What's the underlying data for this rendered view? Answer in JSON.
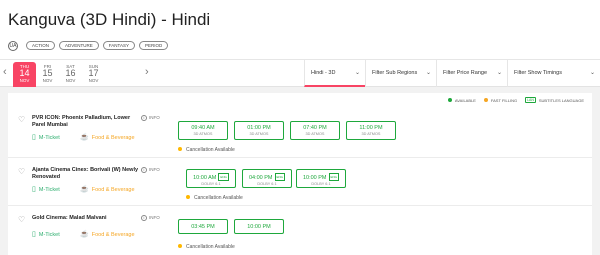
{
  "movie": {
    "title": "Kanguva (3D Hindi) - Hindi",
    "certificate": "UA",
    "genres": [
      "ACTION",
      "ADVENTURE",
      "FANTASY",
      "PERIOD"
    ]
  },
  "dates": [
    {
      "day": "THU",
      "num": "14",
      "mon": "NOV",
      "active": true
    },
    {
      "day": "FRI",
      "num": "15",
      "mon": "NOV"
    },
    {
      "day": "SAT",
      "num": "16",
      "mon": "NOV"
    },
    {
      "day": "SUN",
      "num": "17",
      "mon": "NOV"
    }
  ],
  "filters": {
    "format": "Hindi - 3D",
    "sub_regions": "Filter Sub Regions",
    "price": "Filter Price Range",
    "timings": "Filter Show Timings"
  },
  "legend": {
    "available": "AVAILABLE",
    "fast_filling": "FAST FILLING",
    "lang_box": "LAN",
    "subtitles": "SUBTITLES LANGUAGE"
  },
  "colors": {
    "brand": "#f84464",
    "available": "#1ea83c",
    "fast_filling": "#f5a623"
  },
  "venues": [
    {
      "name": "PVR ICON: Phoenix Palladium, Lower Parel Mumbai",
      "info": "INFO",
      "mticket": "M-Ticket",
      "food": "Food & Beverage",
      "showtimes": [
        {
          "time": "09:40 AM",
          "format": "3D ATMOS"
        },
        {
          "time": "01:00 PM",
          "format": "3D ATMOS"
        },
        {
          "time": "07:40 PM",
          "format": "3D ATMOS"
        },
        {
          "time": "11:00 PM",
          "format": "3D ATMOS"
        }
      ],
      "cancellation": "Cancellation Available"
    },
    {
      "name": "Ajanta Cinema Cinex: Borivali (W) Newly Renovated",
      "info": "INFO",
      "mticket": "M-Ticket",
      "food": "Food & Beverage",
      "showtimes": [
        {
          "time": "10:00 AM",
          "format": "DOLBY 6.1",
          "lang": "ENG"
        },
        {
          "time": "04:00 PM",
          "format": "DOLBY 6.1",
          "lang": "ENG"
        },
        {
          "time": "10:00 PM",
          "format": "DOLBY 6.1",
          "lang": "ENG"
        }
      ],
      "cancellation": "Cancellation Available"
    },
    {
      "name": "Gold Cinema: Malad Malvani",
      "info": "INFO",
      "mticket": "M-Ticket",
      "food": "Food & Beverage",
      "showtimes": [
        {
          "time": "03:45 PM"
        },
        {
          "time": "10:00 PM"
        }
      ],
      "cancellation": "Cancellation Available"
    }
  ]
}
